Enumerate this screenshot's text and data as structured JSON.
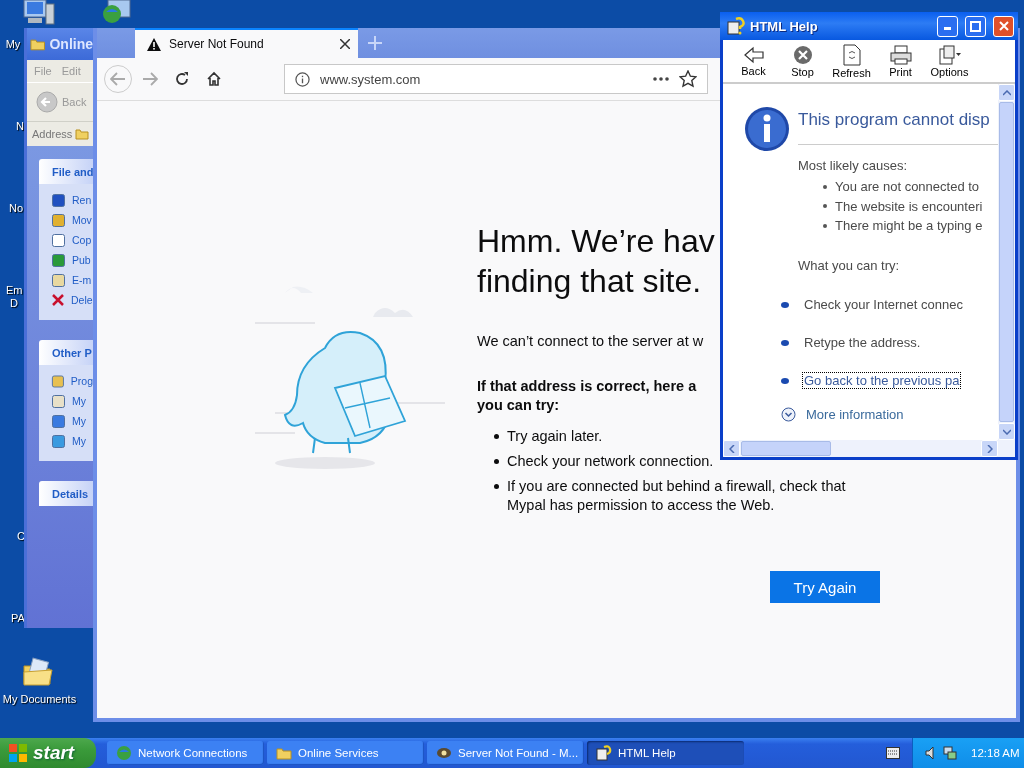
{
  "desktop": {
    "icons": [
      {
        "lines": [
          "My"
        ]
      },
      {
        "lines": [
          "N"
        ]
      },
      {
        "lines": [
          "No"
        ]
      },
      {
        "lines": [
          "Em",
          "D"
        ]
      },
      {
        "lines": [
          "C"
        ]
      },
      {
        "lines": [
          "PA"
        ]
      },
      {
        "lines": [
          "My Documents"
        ]
      }
    ]
  },
  "explorer": {
    "title": "Online",
    "menu": [
      "File",
      "Edit"
    ],
    "back": "Back",
    "address_label": "Address",
    "panels": [
      {
        "title": "File and",
        "items": [
          "Ren",
          "Mov",
          "Cop",
          "Pub",
          "E-m",
          "Dele"
        ]
      },
      {
        "title": "Other P",
        "items": [
          "Prog",
          "My",
          "My",
          "My"
        ]
      },
      {
        "title": "Details"
      }
    ]
  },
  "browser": {
    "tab": {
      "title": "Server Not Found",
      "selected": true
    },
    "url": "www.system.com",
    "page": {
      "heading": [
        "Hmm. We’re hav",
        "finding that site."
      ],
      "message": "We can’t connect to the server at w",
      "suggestions_title": [
        "If that address is correct, here a",
        "you can try:"
      ],
      "suggestions": [
        "Try again later.",
        "Check your network connection.",
        "If you are connected but behind a firewall, check that Mypal has permission to access the Web."
      ],
      "button": "Try Again"
    }
  },
  "help": {
    "title": "HTML Help",
    "toolbar": [
      "Back",
      "Stop",
      "Refresh",
      "Print",
      "Options"
    ],
    "heading": "This program cannot disp",
    "causes_title": "Most likely causes:",
    "causes": [
      "You are not connected to",
      "The website is encounteri",
      "There might be a typing e"
    ],
    "try_title": "What you can try:",
    "tries": [
      {
        "text": "Check your Internet connec",
        "focused": false
      },
      {
        "text": "Retype the address.",
        "focused": false
      },
      {
        "text": "Go back to the previous pa",
        "focused": true
      }
    ],
    "more": "More information"
  },
  "taskbar": {
    "start": "start",
    "tasks": [
      {
        "label": "Network Connections",
        "selected": false
      },
      {
        "label": "Online Services",
        "selected": false
      },
      {
        "label": "Server Not Found - M...",
        "selected": false
      },
      {
        "label": "HTML Help",
        "selected": true
      }
    ],
    "clock": "12:18 AM"
  }
}
